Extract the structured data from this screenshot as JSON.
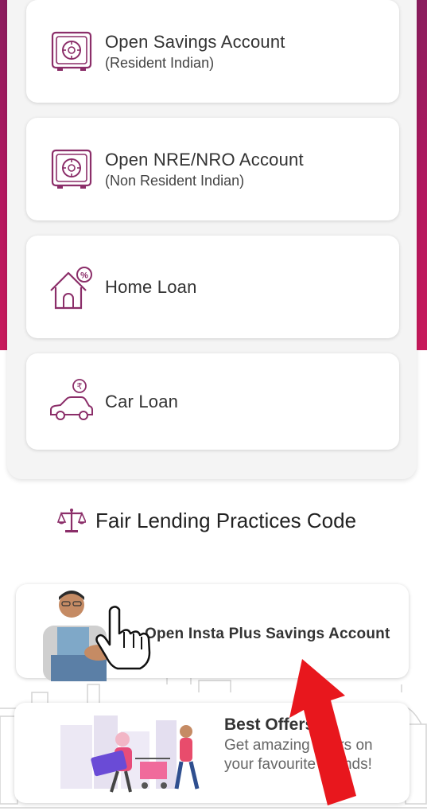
{
  "theme": {
    "accent": "#8f1f61",
    "icon_color": "#8b2e69",
    "arrow_color": "#e8171d"
  },
  "cards": [
    {
      "title": "Open Savings Account",
      "subtitle": "(Resident Indian)",
      "icon": "vault-icon"
    },
    {
      "title": "Open NRE/NRO Account",
      "subtitle": "(Non Resident Indian)",
      "icon": "vault-icon"
    },
    {
      "title": "Home Loan",
      "icon": "home-percent-icon"
    },
    {
      "title": "Car Loan",
      "icon": "car-rupee-icon"
    }
  ],
  "fair_lending": {
    "label": "Fair Lending Practices Code",
    "icon": "scales-icon"
  },
  "insta_banner": {
    "label": "Open Insta Plus Savings Account"
  },
  "offers_banner": {
    "title": "Best Offers",
    "description": "Get amazing offers on your favourite Brands!"
  },
  "annotation": {
    "arrow": "red-arrow-pointer",
    "cursor": "hand-cursor-icon"
  }
}
